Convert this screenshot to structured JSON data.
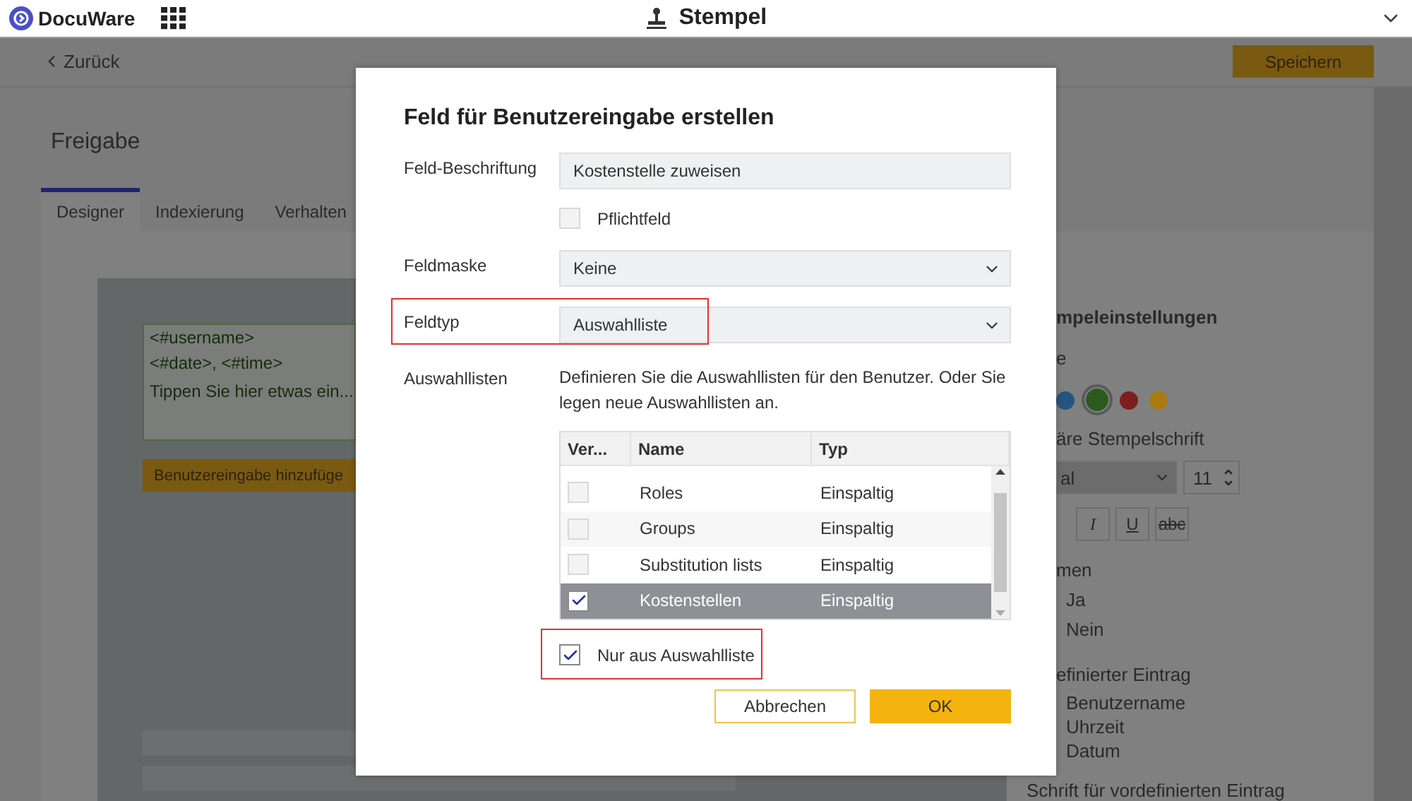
{
  "header": {
    "brand": "DocuWare",
    "title": "Stempel"
  },
  "toolbar": {
    "back": "Zurück",
    "save": "Speichern"
  },
  "page": {
    "title": "Freigabe",
    "tabs": [
      {
        "label": "Designer",
        "selected": true
      },
      {
        "label": "Indexierung",
        "selected": false
      },
      {
        "label": "Verhalten",
        "selected": false
      }
    ]
  },
  "canvas": {
    "stamp_lines": [
      "<#username>",
      "<#date>, <#time>"
    ],
    "stamp_placeholder": "Tippen Sie hier etwas ein...",
    "add_button": "Benutzereingabe hinzufüge"
  },
  "settings": {
    "title": "mpeleinstellungen",
    "color_label": "e",
    "colors": [
      {
        "color": "#25557e",
        "selected": false
      },
      {
        "color": "#2c5a1e",
        "selected": true
      },
      {
        "color": "#7e1e1e",
        "selected": false
      },
      {
        "color": "#a87a10",
        "selected": false
      }
    ],
    "font_label": "äre Stempelschrift",
    "font": "al",
    "size": "11",
    "styles": [
      {
        "label": "I",
        "kind": "italic"
      },
      {
        "label": "U",
        "kind": "underline"
      },
      {
        "label": "abc",
        "kind": "strike"
      }
    ],
    "frame_label": "men",
    "frame_options": [
      "Ja",
      "Nein"
    ],
    "entry_label": "efinierter Eintrag",
    "entries": [
      "Benutzername",
      "Uhrzeit",
      "Datum"
    ],
    "entry_font_label": "Schrift für vordefinierten Eintrag"
  },
  "dialog": {
    "title": "Feld für Benutzereingabe erstellen",
    "fields": [
      {
        "kind": "text",
        "label": "Feld-Beschriftung",
        "value": "Kostenstelle zuweisen"
      },
      {
        "kind": "checkbox",
        "label": "Pflichtfeld",
        "checked": false
      },
      {
        "kind": "select",
        "label": "Feldmaske",
        "value": "Keine",
        "highlighted": false
      },
      {
        "kind": "select",
        "label": "Feldtyp",
        "value": "Auswahlliste",
        "highlighted": true
      }
    ],
    "lists": {
      "label": "Auswahllisten",
      "description": "Definieren Sie die Auswahllisten für den Benutzer. Oder Sie legen neue Auswahllisten an.",
      "columns": [
        "Ver...",
        "Name",
        "Typ"
      ],
      "rows": [
        {
          "checked": false,
          "selected": false,
          "name": "Roles",
          "type": "Einspaltig"
        },
        {
          "checked": false,
          "selected": false,
          "name": "Groups",
          "type": "Einspaltig"
        },
        {
          "checked": false,
          "selected": false,
          "name": "Substitution lists",
          "type": "Einspaltig"
        },
        {
          "checked": true,
          "selected": true,
          "name": "Kostenstellen",
          "type": "Einspaltig"
        }
      ]
    },
    "only_from_list": {
      "label": "Nur aus Auswahlliste",
      "checked": true,
      "highlighted": true
    },
    "buttons": [
      {
        "label": "Abbrechen",
        "kind": "secondary"
      },
      {
        "label": "OK",
        "kind": "primary"
      }
    ]
  }
}
